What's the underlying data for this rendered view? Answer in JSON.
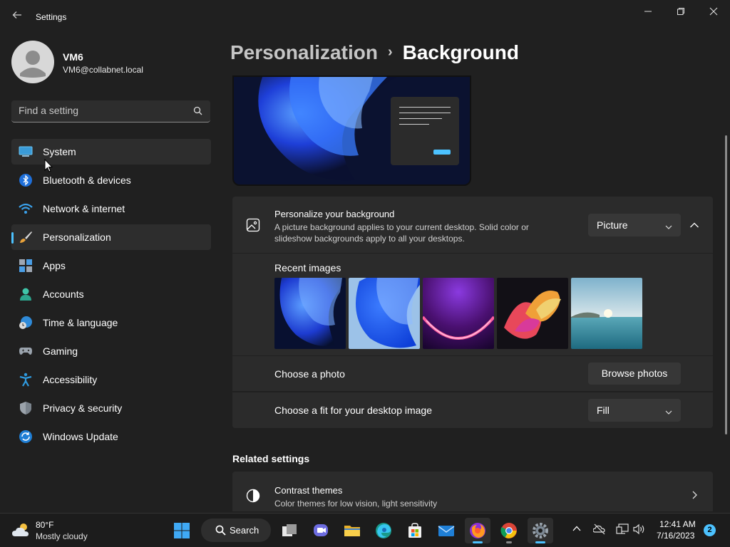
{
  "window": {
    "title": "Settings",
    "back_icon": "back-arrow-icon",
    "controls": [
      "minimize-icon",
      "maximize-icon",
      "close-icon"
    ]
  },
  "profile": {
    "name": "VM6",
    "email": "VM6@collabnet.local"
  },
  "search": {
    "placeholder": "Find a setting",
    "value": ""
  },
  "sidebar": {
    "items": [
      {
        "label": "System",
        "icon": "system-icon"
      },
      {
        "label": "Bluetooth & devices",
        "icon": "bluetooth-icon"
      },
      {
        "label": "Network & internet",
        "icon": "wifi-icon"
      },
      {
        "label": "Personalization",
        "icon": "brush-icon",
        "selected": true
      },
      {
        "label": "Apps",
        "icon": "apps-icon"
      },
      {
        "label": "Accounts",
        "icon": "accounts-icon"
      },
      {
        "label": "Time & language",
        "icon": "clock-globe-icon"
      },
      {
        "label": "Gaming",
        "icon": "gamepad-icon"
      },
      {
        "label": "Accessibility",
        "icon": "accessibility-icon"
      },
      {
        "label": "Privacy & security",
        "icon": "shield-icon"
      },
      {
        "label": "Windows Update",
        "icon": "update-icon"
      }
    ]
  },
  "header": {
    "parent": "Personalization",
    "separator": "›",
    "current": "Background"
  },
  "background_card": {
    "title": "Personalize your background",
    "description": "A picture background applies to your current desktop. Solid color or slideshow backgrounds apply to all your desktops.",
    "type_value": "Picture",
    "recent_images_label": "Recent images",
    "choose_photo_label": "Choose a photo",
    "browse_button": "Browse photos",
    "fit_label": "Choose a fit for your desktop image",
    "fit_value": "Fill"
  },
  "related": {
    "title": "Related settings",
    "contrast_title": "Contrast themes",
    "contrast_desc": "Color themes for low vision, light sensitivity"
  },
  "taskbar": {
    "weather_temp": "80°F",
    "weather_desc": "Mostly cloudy",
    "search_label": "Search",
    "time": "12:41 AM",
    "date": "7/16/2023",
    "notifications": "2"
  },
  "colors": {
    "accent": "#4cc2ff",
    "background": "#202020",
    "card": "#2b2b2b"
  }
}
